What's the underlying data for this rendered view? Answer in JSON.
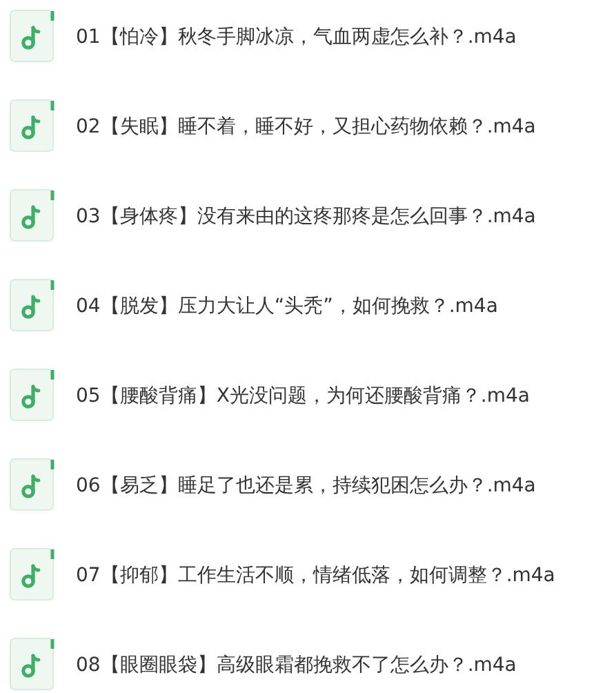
{
  "files": [
    {
      "name": "01【怕冷】秋冬手脚冰凉，气血两虚怎么补？.m4a"
    },
    {
      "name": "02【失眠】睡不着，睡不好，又担心药物依赖？.m4a"
    },
    {
      "name": "03【身体疼】没有来由的这疼那疼是怎么回事？.m4a"
    },
    {
      "name": "04【脱发】压力大让人“头秃”，如何挽救？.m4a"
    },
    {
      "name": "05【腰酸背痛】X光没问题，为何还腰酸背痛？.m4a"
    },
    {
      "name": "06【易乏】睡足了也还是累，持续犯困怎么办？.m4a"
    },
    {
      "name": "07【抑郁】工作生活不顺，情绪低落，如何调整？.m4a"
    },
    {
      "name": "08【眼圈眼袋】高级眼霜都挽救不了怎么办？.m4a"
    }
  ]
}
